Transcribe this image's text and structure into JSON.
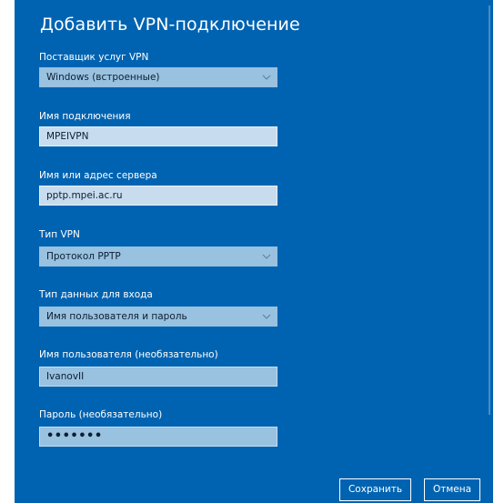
{
  "dialog": {
    "title": "Добавить VPN-подключение"
  },
  "fields": {
    "provider": {
      "label": "Поставщик услуг VPN",
      "value": "Windows (встроенные)"
    },
    "connection_name": {
      "label": "Имя подключения",
      "value": "MPEIVPN"
    },
    "server": {
      "label": "Имя или адрес сервера",
      "value": "pptp.mpei.ac.ru"
    },
    "vpn_type": {
      "label": "Тип VPN",
      "value": "Протокол PPTP"
    },
    "signin_type": {
      "label": "Тип данных для входа",
      "value": "Имя пользователя и пароль"
    },
    "username": {
      "label": "Имя пользователя (необязательно)",
      "value": "IvanovII"
    },
    "password": {
      "label": "Пароль (необязательно)",
      "value": "•••••••"
    }
  },
  "buttons": {
    "save": "Сохранить",
    "cancel": "Отмена"
  },
  "icons": {
    "dropdown": "chevron-down-icon"
  },
  "colors": {
    "background": "#0063b1",
    "combo_fill": "#99c1e0",
    "textbox_fill": "#c7ddef"
  }
}
